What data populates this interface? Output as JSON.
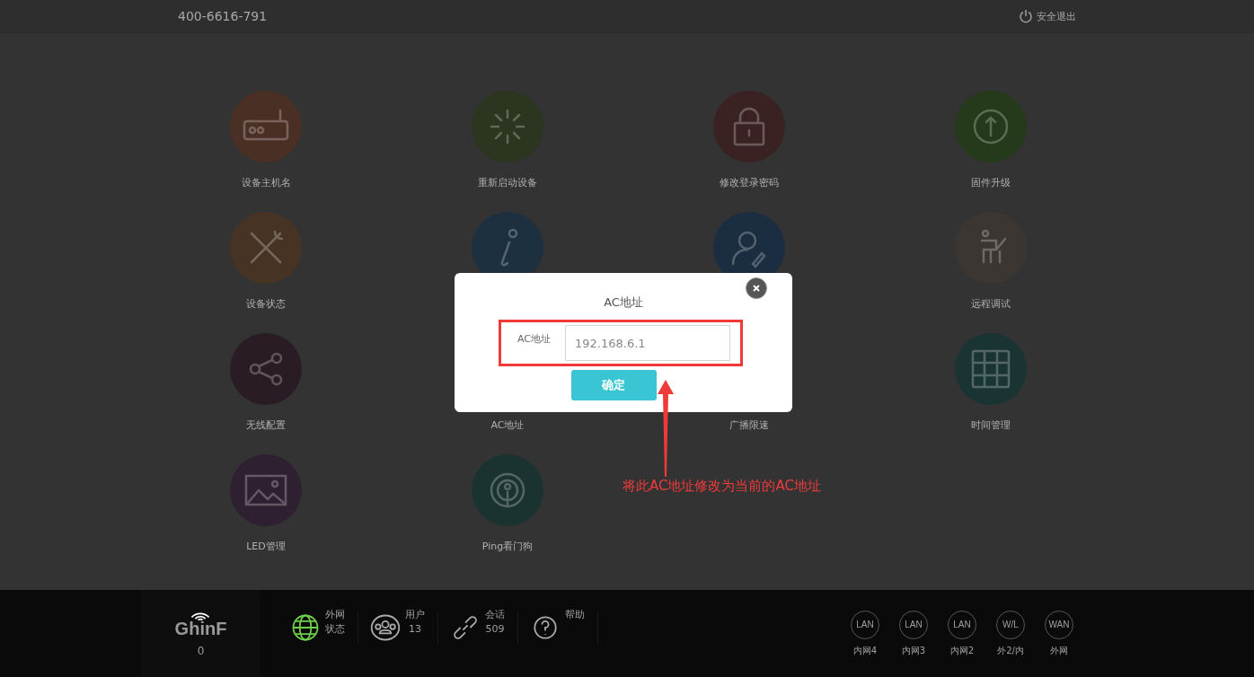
{
  "top_bar": {
    "phone": "400-6616-791",
    "logout": "安全退出"
  },
  "tiles": [
    {
      "kind": "router",
      "color": "#4a2f25",
      "label": "设备主机名"
    },
    {
      "kind": "reboot",
      "color": "#2b3520",
      "label": "重新启动设备"
    },
    {
      "kind": "lock",
      "color": "#3a2222",
      "label": "修改登录密码"
    },
    {
      "kind": "upgrade",
      "color": "#243a1a",
      "label": "固件升级"
    },
    {
      "kind": "tools",
      "color": "#473324",
      "label": "设备状态"
    },
    {
      "kind": "info",
      "color": "#1d3040"
    },
    {
      "kind": "user",
      "color": "#1b2d40"
    },
    {
      "kind": "desk",
      "color": "#3b3632",
      "label": "远程调试"
    },
    {
      "kind": "share",
      "color": "#2a1c24",
      "label": "无线配置"
    },
    {
      "label": "AC地址"
    },
    {
      "label": "广播限速"
    },
    {
      "kind": "grid",
      "color": "#1a3434",
      "label": "时间管理"
    },
    {
      "kind": "image",
      "color": "#2e2030",
      "label": "LED管理"
    },
    {
      "kind": "ping",
      "color": "#1a3330",
      "label": "Ping看门狗"
    }
  ],
  "dialog": {
    "title": "AC地址",
    "field_label": "AC地址",
    "field_value": "192.168.6.1",
    "confirm": "确定"
  },
  "annotation": "将此AC地址修改为当前的AC地址",
  "footer": {
    "brand": "GhinF",
    "brand_count": "0",
    "stats": [
      {
        "kind": "globe",
        "label": "外网",
        "value": "状态"
      },
      {
        "kind": "users",
        "label": "用户",
        "value": "13"
      },
      {
        "kind": "link",
        "label": "会话",
        "value": "509"
      },
      {
        "kind": "help",
        "label": "帮助"
      }
    ],
    "ports": [
      {
        "badge": "LAN",
        "label": "内网4"
      },
      {
        "badge": "LAN",
        "label": "内网3"
      },
      {
        "badge": "LAN",
        "label": "内网2"
      },
      {
        "badge": "W/L",
        "label": "外2/内"
      },
      {
        "badge": "WAN",
        "label": "外网"
      }
    ]
  }
}
